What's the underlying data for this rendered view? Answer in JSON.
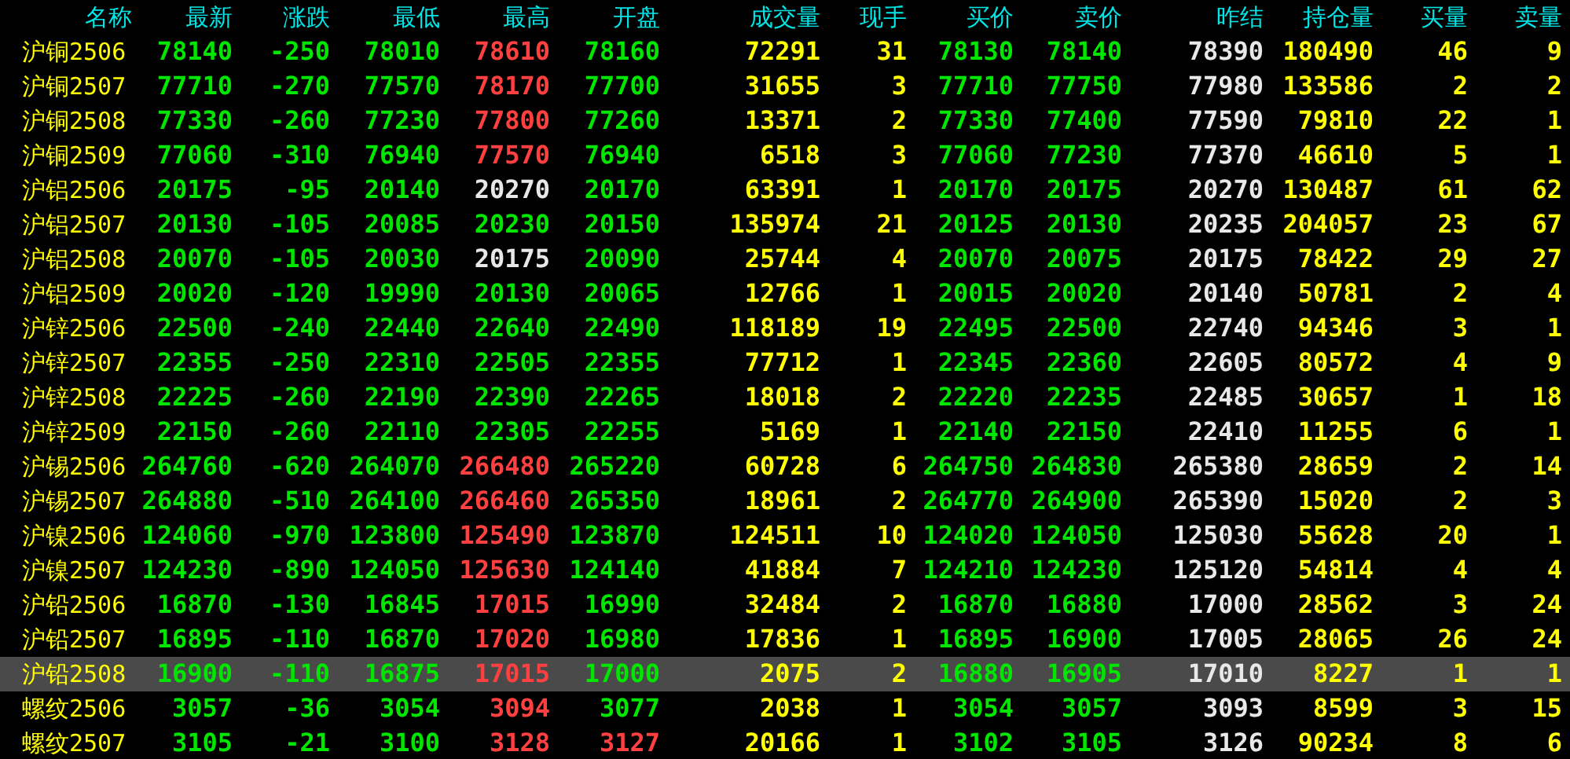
{
  "columns": [
    "名称",
    "最新",
    "涨跌",
    "最低",
    "最高",
    "开盘",
    "成交量",
    "现手",
    "买价",
    "卖价",
    "昨结",
    "持仓量",
    "买量",
    "卖量"
  ],
  "rows": [
    {
      "name": "沪铜2506",
      "selected": false,
      "cells": [
        {
          "text": "78140",
          "color": "#00e600"
        },
        {
          "text": "-250",
          "color": "#00e600"
        },
        {
          "text": "78010",
          "color": "#00e600"
        },
        {
          "text": "78610",
          "color": "#ff4040"
        },
        {
          "text": "78160",
          "color": "#00e600"
        },
        {
          "text": "72291",
          "color": "#ffff00"
        },
        {
          "text": "31",
          "color": "#ffff00"
        },
        {
          "text": "78130",
          "color": "#00e600"
        },
        {
          "text": "78140",
          "color": "#00e600"
        },
        {
          "text": "78390",
          "color": "#e8e8e8"
        },
        {
          "text": "180490",
          "color": "#ffff00"
        },
        {
          "text": "46",
          "color": "#ffff00"
        },
        {
          "text": "9",
          "color": "#ffff00"
        }
      ]
    },
    {
      "name": "沪铜2507",
      "selected": false,
      "cells": [
        {
          "text": "77710",
          "color": "#00e600"
        },
        {
          "text": "-270",
          "color": "#00e600"
        },
        {
          "text": "77570",
          "color": "#00e600"
        },
        {
          "text": "78170",
          "color": "#ff4040"
        },
        {
          "text": "77700",
          "color": "#00e600"
        },
        {
          "text": "31655",
          "color": "#ffff00"
        },
        {
          "text": "3",
          "color": "#ffff00"
        },
        {
          "text": "77710",
          "color": "#00e600"
        },
        {
          "text": "77750",
          "color": "#00e600"
        },
        {
          "text": "77980",
          "color": "#e8e8e8"
        },
        {
          "text": "133586",
          "color": "#ffff00"
        },
        {
          "text": "2",
          "color": "#ffff00"
        },
        {
          "text": "2",
          "color": "#ffff00"
        }
      ]
    },
    {
      "name": "沪铜2508",
      "selected": false,
      "cells": [
        {
          "text": "77330",
          "color": "#00e600"
        },
        {
          "text": "-260",
          "color": "#00e600"
        },
        {
          "text": "77230",
          "color": "#00e600"
        },
        {
          "text": "77800",
          "color": "#ff4040"
        },
        {
          "text": "77260",
          "color": "#00e600"
        },
        {
          "text": "13371",
          "color": "#ffff00"
        },
        {
          "text": "2",
          "color": "#ffff00"
        },
        {
          "text": "77330",
          "color": "#00e600"
        },
        {
          "text": "77400",
          "color": "#00e600"
        },
        {
          "text": "77590",
          "color": "#e8e8e8"
        },
        {
          "text": "79810",
          "color": "#ffff00"
        },
        {
          "text": "22",
          "color": "#ffff00"
        },
        {
          "text": "1",
          "color": "#ffff00"
        }
      ]
    },
    {
      "name": "沪铜2509",
      "selected": false,
      "cells": [
        {
          "text": "77060",
          "color": "#00e600"
        },
        {
          "text": "-310",
          "color": "#00e600"
        },
        {
          "text": "76940",
          "color": "#00e600"
        },
        {
          "text": "77570",
          "color": "#ff4040"
        },
        {
          "text": "76940",
          "color": "#00e600"
        },
        {
          "text": "6518",
          "color": "#ffff00"
        },
        {
          "text": "3",
          "color": "#ffff00"
        },
        {
          "text": "77060",
          "color": "#00e600"
        },
        {
          "text": "77230",
          "color": "#00e600"
        },
        {
          "text": "77370",
          "color": "#e8e8e8"
        },
        {
          "text": "46610",
          "color": "#ffff00"
        },
        {
          "text": "5",
          "color": "#ffff00"
        },
        {
          "text": "1",
          "color": "#ffff00"
        }
      ]
    },
    {
      "name": "沪铝2506",
      "selected": false,
      "cells": [
        {
          "text": "20175",
          "color": "#00e600"
        },
        {
          "text": "-95",
          "color": "#00e600"
        },
        {
          "text": "20140",
          "color": "#00e600"
        },
        {
          "text": "20270",
          "color": "#e8e8e8"
        },
        {
          "text": "20170",
          "color": "#00e600"
        },
        {
          "text": "63391",
          "color": "#ffff00"
        },
        {
          "text": "1",
          "color": "#ffff00"
        },
        {
          "text": "20170",
          "color": "#00e600"
        },
        {
          "text": "20175",
          "color": "#00e600"
        },
        {
          "text": "20270",
          "color": "#e8e8e8"
        },
        {
          "text": "130487",
          "color": "#ffff00"
        },
        {
          "text": "61",
          "color": "#ffff00"
        },
        {
          "text": "62",
          "color": "#ffff00"
        }
      ]
    },
    {
      "name": "沪铝2507",
      "selected": false,
      "cells": [
        {
          "text": "20130",
          "color": "#00e600"
        },
        {
          "text": "-105",
          "color": "#00e600"
        },
        {
          "text": "20085",
          "color": "#00e600"
        },
        {
          "text": "20230",
          "color": "#00e600"
        },
        {
          "text": "20150",
          "color": "#00e600"
        },
        {
          "text": "135974",
          "color": "#ffff00"
        },
        {
          "text": "21",
          "color": "#ffff00"
        },
        {
          "text": "20125",
          "color": "#00e600"
        },
        {
          "text": "20130",
          "color": "#00e600"
        },
        {
          "text": "20235",
          "color": "#e8e8e8"
        },
        {
          "text": "204057",
          "color": "#ffff00"
        },
        {
          "text": "23",
          "color": "#ffff00"
        },
        {
          "text": "67",
          "color": "#ffff00"
        }
      ]
    },
    {
      "name": "沪铝2508",
      "selected": false,
      "cells": [
        {
          "text": "20070",
          "color": "#00e600"
        },
        {
          "text": "-105",
          "color": "#00e600"
        },
        {
          "text": "20030",
          "color": "#00e600"
        },
        {
          "text": "20175",
          "color": "#e8e8e8"
        },
        {
          "text": "20090",
          "color": "#00e600"
        },
        {
          "text": "25744",
          "color": "#ffff00"
        },
        {
          "text": "4",
          "color": "#ffff00"
        },
        {
          "text": "20070",
          "color": "#00e600"
        },
        {
          "text": "20075",
          "color": "#00e600"
        },
        {
          "text": "20175",
          "color": "#e8e8e8"
        },
        {
          "text": "78422",
          "color": "#ffff00"
        },
        {
          "text": "29",
          "color": "#ffff00"
        },
        {
          "text": "27",
          "color": "#ffff00"
        }
      ]
    },
    {
      "name": "沪铝2509",
      "selected": false,
      "cells": [
        {
          "text": "20020",
          "color": "#00e600"
        },
        {
          "text": "-120",
          "color": "#00e600"
        },
        {
          "text": "19990",
          "color": "#00e600"
        },
        {
          "text": "20130",
          "color": "#00e600"
        },
        {
          "text": "20065",
          "color": "#00e600"
        },
        {
          "text": "12766",
          "color": "#ffff00"
        },
        {
          "text": "1",
          "color": "#ffff00"
        },
        {
          "text": "20015",
          "color": "#00e600"
        },
        {
          "text": "20020",
          "color": "#00e600"
        },
        {
          "text": "20140",
          "color": "#e8e8e8"
        },
        {
          "text": "50781",
          "color": "#ffff00"
        },
        {
          "text": "2",
          "color": "#ffff00"
        },
        {
          "text": "4",
          "color": "#ffff00"
        }
      ]
    },
    {
      "name": "沪锌2506",
      "selected": false,
      "cells": [
        {
          "text": "22500",
          "color": "#00e600"
        },
        {
          "text": "-240",
          "color": "#00e600"
        },
        {
          "text": "22440",
          "color": "#00e600"
        },
        {
          "text": "22640",
          "color": "#00e600"
        },
        {
          "text": "22490",
          "color": "#00e600"
        },
        {
          "text": "118189",
          "color": "#ffff00"
        },
        {
          "text": "19",
          "color": "#ffff00"
        },
        {
          "text": "22495",
          "color": "#00e600"
        },
        {
          "text": "22500",
          "color": "#00e600"
        },
        {
          "text": "22740",
          "color": "#e8e8e8"
        },
        {
          "text": "94346",
          "color": "#ffff00"
        },
        {
          "text": "3",
          "color": "#ffff00"
        },
        {
          "text": "1",
          "color": "#ffff00"
        }
      ]
    },
    {
      "name": "沪锌2507",
      "selected": false,
      "cells": [
        {
          "text": "22355",
          "color": "#00e600"
        },
        {
          "text": "-250",
          "color": "#00e600"
        },
        {
          "text": "22310",
          "color": "#00e600"
        },
        {
          "text": "22505",
          "color": "#00e600"
        },
        {
          "text": "22355",
          "color": "#00e600"
        },
        {
          "text": "77712",
          "color": "#ffff00"
        },
        {
          "text": "1",
          "color": "#ffff00"
        },
        {
          "text": "22345",
          "color": "#00e600"
        },
        {
          "text": "22360",
          "color": "#00e600"
        },
        {
          "text": "22605",
          "color": "#e8e8e8"
        },
        {
          "text": "80572",
          "color": "#ffff00"
        },
        {
          "text": "4",
          "color": "#ffff00"
        },
        {
          "text": "9",
          "color": "#ffff00"
        }
      ]
    },
    {
      "name": "沪锌2508",
      "selected": false,
      "cells": [
        {
          "text": "22225",
          "color": "#00e600"
        },
        {
          "text": "-260",
          "color": "#00e600"
        },
        {
          "text": "22190",
          "color": "#00e600"
        },
        {
          "text": "22390",
          "color": "#00e600"
        },
        {
          "text": "22265",
          "color": "#00e600"
        },
        {
          "text": "18018",
          "color": "#ffff00"
        },
        {
          "text": "2",
          "color": "#ffff00"
        },
        {
          "text": "22220",
          "color": "#00e600"
        },
        {
          "text": "22235",
          "color": "#00e600"
        },
        {
          "text": "22485",
          "color": "#e8e8e8"
        },
        {
          "text": "30657",
          "color": "#ffff00"
        },
        {
          "text": "1",
          "color": "#ffff00"
        },
        {
          "text": "18",
          "color": "#ffff00"
        }
      ]
    },
    {
      "name": "沪锌2509",
      "selected": false,
      "cells": [
        {
          "text": "22150",
          "color": "#00e600"
        },
        {
          "text": "-260",
          "color": "#00e600"
        },
        {
          "text": "22110",
          "color": "#00e600"
        },
        {
          "text": "22305",
          "color": "#00e600"
        },
        {
          "text": "22255",
          "color": "#00e600"
        },
        {
          "text": "5169",
          "color": "#ffff00"
        },
        {
          "text": "1",
          "color": "#ffff00"
        },
        {
          "text": "22140",
          "color": "#00e600"
        },
        {
          "text": "22150",
          "color": "#00e600"
        },
        {
          "text": "22410",
          "color": "#e8e8e8"
        },
        {
          "text": "11255",
          "color": "#ffff00"
        },
        {
          "text": "6",
          "color": "#ffff00"
        },
        {
          "text": "1",
          "color": "#ffff00"
        }
      ]
    },
    {
      "name": "沪锡2506",
      "selected": false,
      "cells": [
        {
          "text": "264760",
          "color": "#00e600"
        },
        {
          "text": "-620",
          "color": "#00e600"
        },
        {
          "text": "264070",
          "color": "#00e600"
        },
        {
          "text": "266480",
          "color": "#ff4040"
        },
        {
          "text": "265220",
          "color": "#00e600"
        },
        {
          "text": "60728",
          "color": "#ffff00"
        },
        {
          "text": "6",
          "color": "#ffff00"
        },
        {
          "text": "264750",
          "color": "#00e600"
        },
        {
          "text": "264830",
          "color": "#00e600"
        },
        {
          "text": "265380",
          "color": "#e8e8e8"
        },
        {
          "text": "28659",
          "color": "#ffff00"
        },
        {
          "text": "2",
          "color": "#ffff00"
        },
        {
          "text": "14",
          "color": "#ffff00"
        }
      ]
    },
    {
      "name": "沪锡2507",
      "selected": false,
      "cells": [
        {
          "text": "264880",
          "color": "#00e600"
        },
        {
          "text": "-510",
          "color": "#00e600"
        },
        {
          "text": "264100",
          "color": "#00e600"
        },
        {
          "text": "266460",
          "color": "#ff4040"
        },
        {
          "text": "265350",
          "color": "#00e600"
        },
        {
          "text": "18961",
          "color": "#ffff00"
        },
        {
          "text": "2",
          "color": "#ffff00"
        },
        {
          "text": "264770",
          "color": "#00e600"
        },
        {
          "text": "264900",
          "color": "#00e600"
        },
        {
          "text": "265390",
          "color": "#e8e8e8"
        },
        {
          "text": "15020",
          "color": "#ffff00"
        },
        {
          "text": "2",
          "color": "#ffff00"
        },
        {
          "text": "3",
          "color": "#ffff00"
        }
      ]
    },
    {
      "name": "沪镍2506",
      "selected": false,
      "cells": [
        {
          "text": "124060",
          "color": "#00e600"
        },
        {
          "text": "-970",
          "color": "#00e600"
        },
        {
          "text": "123800",
          "color": "#00e600"
        },
        {
          "text": "125490",
          "color": "#ff4040"
        },
        {
          "text": "123870",
          "color": "#00e600"
        },
        {
          "text": "124511",
          "color": "#ffff00"
        },
        {
          "text": "10",
          "color": "#ffff00"
        },
        {
          "text": "124020",
          "color": "#00e600"
        },
        {
          "text": "124050",
          "color": "#00e600"
        },
        {
          "text": "125030",
          "color": "#e8e8e8"
        },
        {
          "text": "55628",
          "color": "#ffff00"
        },
        {
          "text": "20",
          "color": "#ffff00"
        },
        {
          "text": "1",
          "color": "#ffff00"
        }
      ]
    },
    {
      "name": "沪镍2507",
      "selected": false,
      "cells": [
        {
          "text": "124230",
          "color": "#00e600"
        },
        {
          "text": "-890",
          "color": "#00e600"
        },
        {
          "text": "124050",
          "color": "#00e600"
        },
        {
          "text": "125630",
          "color": "#ff4040"
        },
        {
          "text": "124140",
          "color": "#00e600"
        },
        {
          "text": "41884",
          "color": "#ffff00"
        },
        {
          "text": "7",
          "color": "#ffff00"
        },
        {
          "text": "124210",
          "color": "#00e600"
        },
        {
          "text": "124230",
          "color": "#00e600"
        },
        {
          "text": "125120",
          "color": "#e8e8e8"
        },
        {
          "text": "54814",
          "color": "#ffff00"
        },
        {
          "text": "4",
          "color": "#ffff00"
        },
        {
          "text": "4",
          "color": "#ffff00"
        }
      ]
    },
    {
      "name": "沪铅2506",
      "selected": false,
      "cells": [
        {
          "text": "16870",
          "color": "#00e600"
        },
        {
          "text": "-130",
          "color": "#00e600"
        },
        {
          "text": "16845",
          "color": "#00e600"
        },
        {
          "text": "17015",
          "color": "#ff4040"
        },
        {
          "text": "16990",
          "color": "#00e600"
        },
        {
          "text": "32484",
          "color": "#ffff00"
        },
        {
          "text": "2",
          "color": "#ffff00"
        },
        {
          "text": "16870",
          "color": "#00e600"
        },
        {
          "text": "16880",
          "color": "#00e600"
        },
        {
          "text": "17000",
          "color": "#e8e8e8"
        },
        {
          "text": "28562",
          "color": "#ffff00"
        },
        {
          "text": "3",
          "color": "#ffff00"
        },
        {
          "text": "24",
          "color": "#ffff00"
        }
      ]
    },
    {
      "name": "沪铅2507",
      "selected": false,
      "cells": [
        {
          "text": "16895",
          "color": "#00e600"
        },
        {
          "text": "-110",
          "color": "#00e600"
        },
        {
          "text": "16870",
          "color": "#00e600"
        },
        {
          "text": "17020",
          "color": "#ff4040"
        },
        {
          "text": "16980",
          "color": "#00e600"
        },
        {
          "text": "17836",
          "color": "#ffff00"
        },
        {
          "text": "1",
          "color": "#ffff00"
        },
        {
          "text": "16895",
          "color": "#00e600"
        },
        {
          "text": "16900",
          "color": "#00e600"
        },
        {
          "text": "17005",
          "color": "#e8e8e8"
        },
        {
          "text": "28065",
          "color": "#ffff00"
        },
        {
          "text": "26",
          "color": "#ffff00"
        },
        {
          "text": "24",
          "color": "#ffff00"
        }
      ]
    },
    {
      "name": "沪铅2508",
      "selected": true,
      "cells": [
        {
          "text": "16900",
          "color": "#00e600"
        },
        {
          "text": "-110",
          "color": "#00e600"
        },
        {
          "text": "16875",
          "color": "#00e600"
        },
        {
          "text": "17015",
          "color": "#ff4040"
        },
        {
          "text": "17000",
          "color": "#00e600"
        },
        {
          "text": "2075",
          "color": "#ffff00"
        },
        {
          "text": "2",
          "color": "#ffff00"
        },
        {
          "text": "16880",
          "color": "#00e600"
        },
        {
          "text": "16905",
          "color": "#00e600"
        },
        {
          "text": "17010",
          "color": "#e8e8e8"
        },
        {
          "text": "8227",
          "color": "#ffff00"
        },
        {
          "text": "1",
          "color": "#ffff00"
        },
        {
          "text": "1",
          "color": "#ffff00"
        }
      ]
    },
    {
      "name": "螺纹2506",
      "selected": false,
      "cells": [
        {
          "text": "3057",
          "color": "#00e600"
        },
        {
          "text": "-36",
          "color": "#00e600"
        },
        {
          "text": "3054",
          "color": "#00e600"
        },
        {
          "text": "3094",
          "color": "#ff4040"
        },
        {
          "text": "3077",
          "color": "#00e600"
        },
        {
          "text": "2038",
          "color": "#ffff00"
        },
        {
          "text": "1",
          "color": "#ffff00"
        },
        {
          "text": "3054",
          "color": "#00e600"
        },
        {
          "text": "3057",
          "color": "#00e600"
        },
        {
          "text": "3093",
          "color": "#e8e8e8"
        },
        {
          "text": "8599",
          "color": "#ffff00"
        },
        {
          "text": "3",
          "color": "#ffff00"
        },
        {
          "text": "15",
          "color": "#ffff00"
        }
      ]
    },
    {
      "name": "螺纹2507",
      "selected": false,
      "cells": [
        {
          "text": "3105",
          "color": "#00e600"
        },
        {
          "text": "-21",
          "color": "#00e600"
        },
        {
          "text": "3100",
          "color": "#00e600"
        },
        {
          "text": "3128",
          "color": "#ff4040"
        },
        {
          "text": "3127",
          "color": "#ff4040"
        },
        {
          "text": "20166",
          "color": "#ffff00"
        },
        {
          "text": "1",
          "color": "#ffff00"
        },
        {
          "text": "3102",
          "color": "#00e600"
        },
        {
          "text": "3105",
          "color": "#00e600"
        },
        {
          "text": "3126",
          "color": "#e8e8e8"
        },
        {
          "text": "90234",
          "color": "#ffff00"
        },
        {
          "text": "8",
          "color": "#ffff00"
        },
        {
          "text": "6",
          "color": "#ffff00"
        }
      ]
    }
  ]
}
